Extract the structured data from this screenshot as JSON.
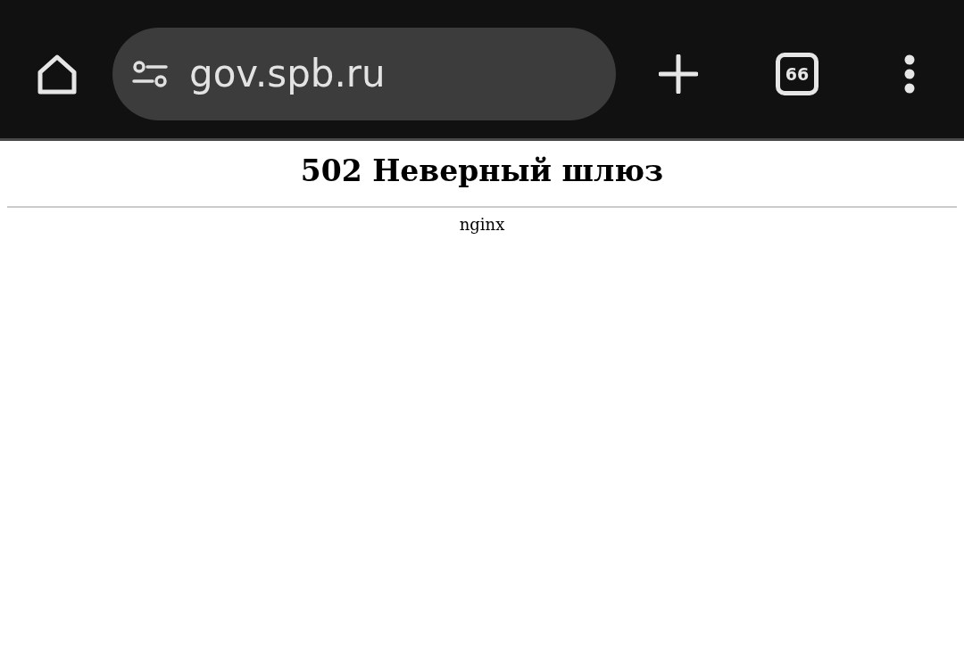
{
  "toolbar": {
    "url": "gov.spb.ru",
    "tab_count": "66"
  },
  "page": {
    "heading": "502 Неверный шлюз",
    "server": "nginx"
  }
}
